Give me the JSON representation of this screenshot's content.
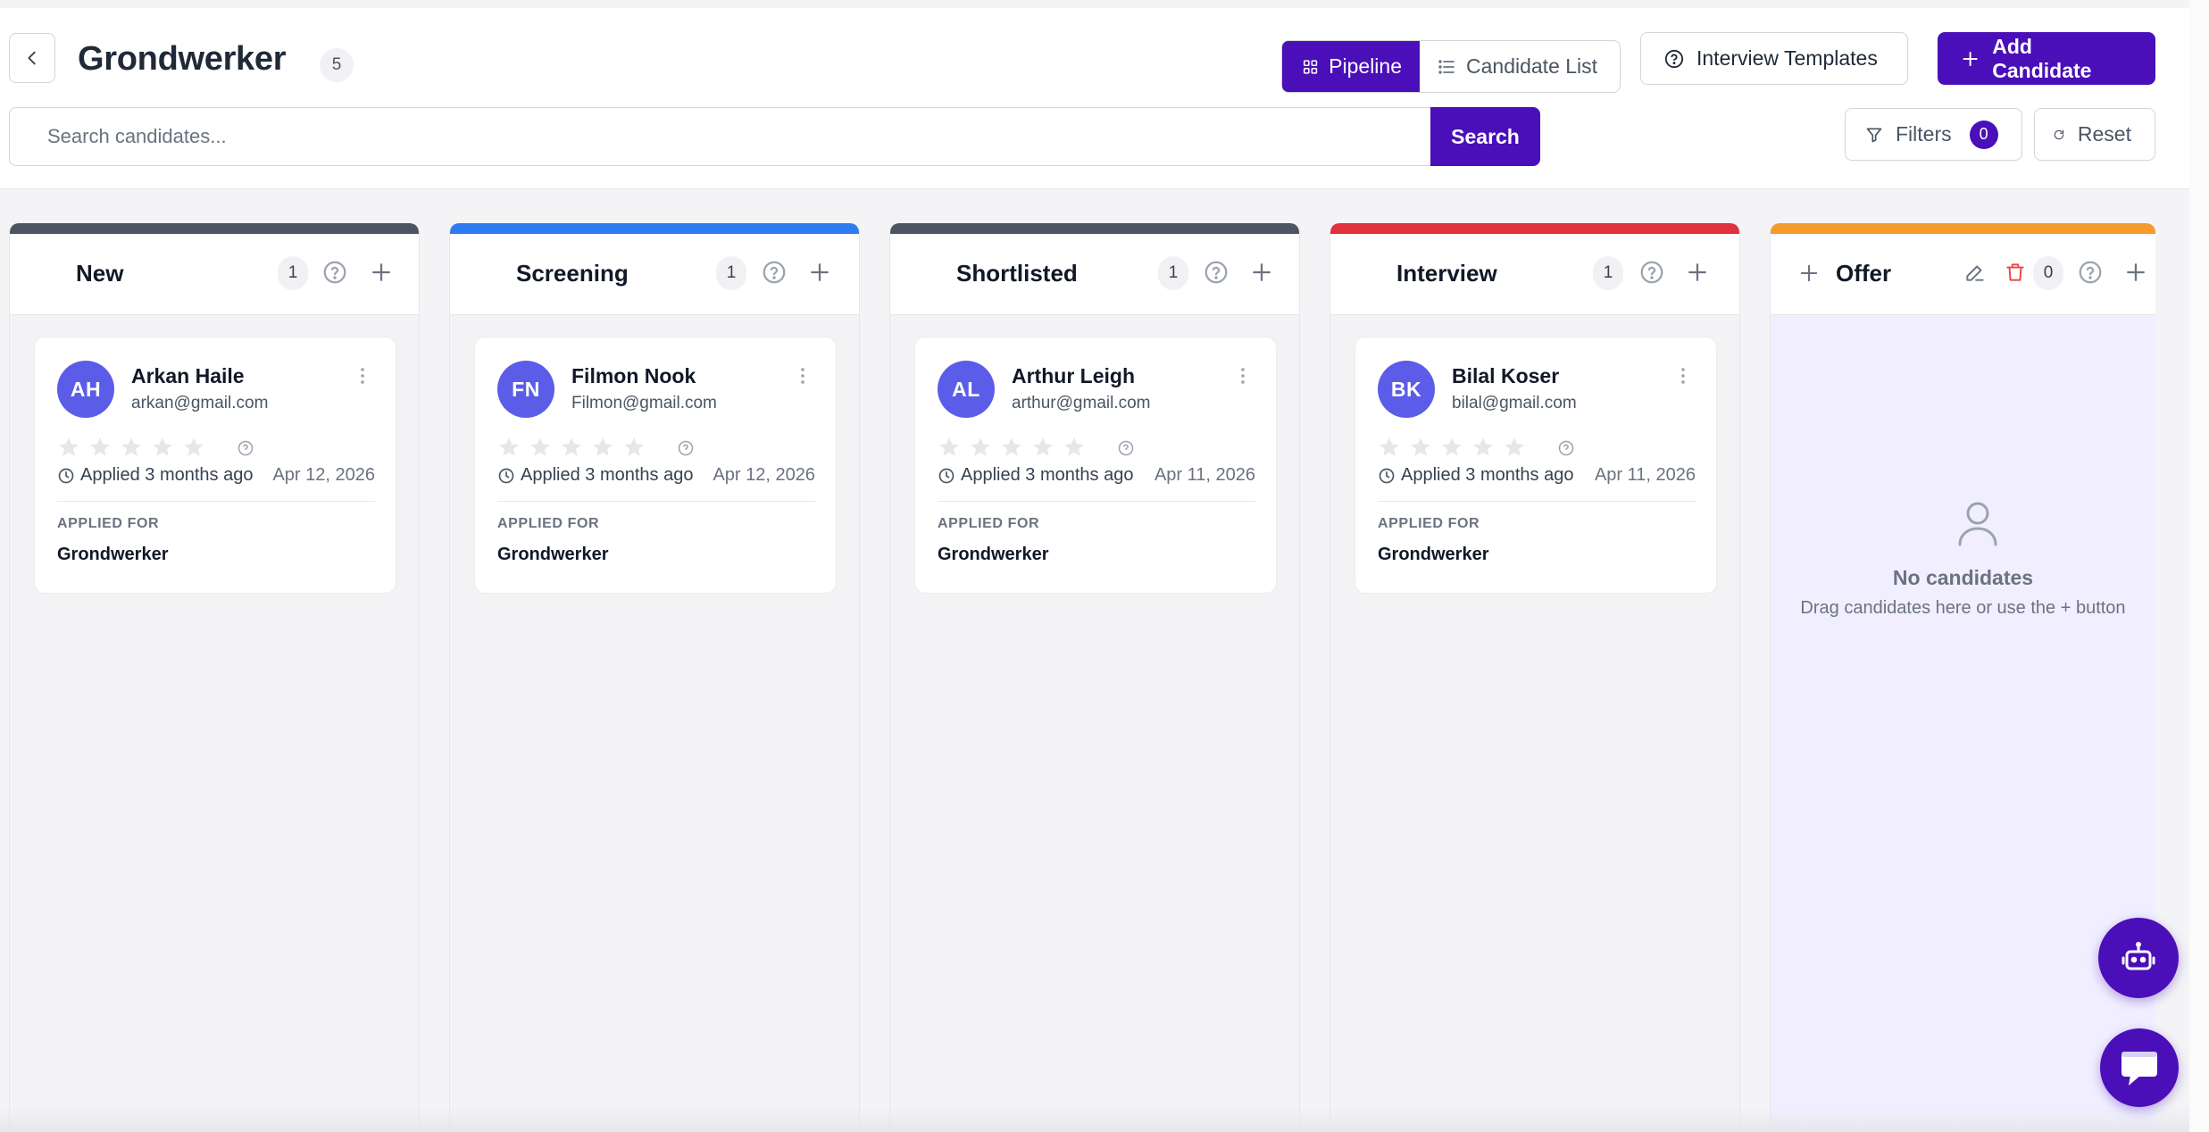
{
  "header": {
    "title": "Grondwerker",
    "count": "5",
    "view_pipeline": "Pipeline",
    "view_list": "Candidate List",
    "interview_templates": "Interview Templates",
    "add_candidate": "Add Candidate"
  },
  "search": {
    "placeholder": "Search candidates...",
    "button": "Search"
  },
  "filters": {
    "label": "Filters",
    "count": "0",
    "reset": "Reset"
  },
  "colors": {
    "brand": "#4a0fb8",
    "avatar": "#5b5ce8",
    "stage_new": "#4b5563",
    "stage_screening": "#2f7cf2",
    "stage_shortlisted": "#4b5563",
    "stage_interview": "#e0313d",
    "stage_offer": "#f59a2c"
  },
  "columns": [
    {
      "name": "New",
      "count": "1",
      "card": {
        "initials": "AH",
        "name": "Arkan Haile",
        "email": "arkan@gmail.com",
        "rating": 0,
        "applied": "Applied 3 months ago",
        "date": "Apr 12, 2026",
        "applied_for_label": "APPLIED FOR",
        "applied_for": "Grondwerker"
      }
    },
    {
      "name": "Screening",
      "count": "1",
      "card": {
        "initials": "FN",
        "name": "Filmon Nook",
        "email": "Filmon@gmail.com",
        "rating": 0,
        "applied": "Applied 3 months ago",
        "date": "Apr 12, 2026",
        "applied_for_label": "APPLIED FOR",
        "applied_for": "Grondwerker"
      }
    },
    {
      "name": "Shortlisted",
      "count": "1",
      "card": {
        "initials": "AL",
        "name": "Arthur Leigh",
        "email": "arthur@gmail.com",
        "rating": 0,
        "applied": "Applied 3 months ago",
        "date": "Apr 11, 2026",
        "applied_for_label": "APPLIED FOR",
        "applied_for": "Grondwerker"
      }
    },
    {
      "name": "Interview",
      "count": "1",
      "card": {
        "initials": "BK",
        "name": "Bilal Koser",
        "email": "bilal@gmail.com",
        "rating": 0,
        "applied": "Applied 3 months ago",
        "date": "Apr 11, 2026",
        "applied_for_label": "APPLIED FOR",
        "applied_for": "Grondwerker"
      }
    },
    {
      "name": "Offer",
      "count": "0",
      "empty_title": "No candidates",
      "empty_sub": "Drag candidates here or use the + button"
    }
  ],
  "icons": {
    "back": "chevron-left-icon",
    "pipeline": "grid-icon",
    "list": "list-icon",
    "templates": "help-circle-icon",
    "add": "plus-icon",
    "filter": "filter-icon",
    "reset": "refresh-icon",
    "bot": "robot-icon",
    "chat": "chat-icon"
  }
}
